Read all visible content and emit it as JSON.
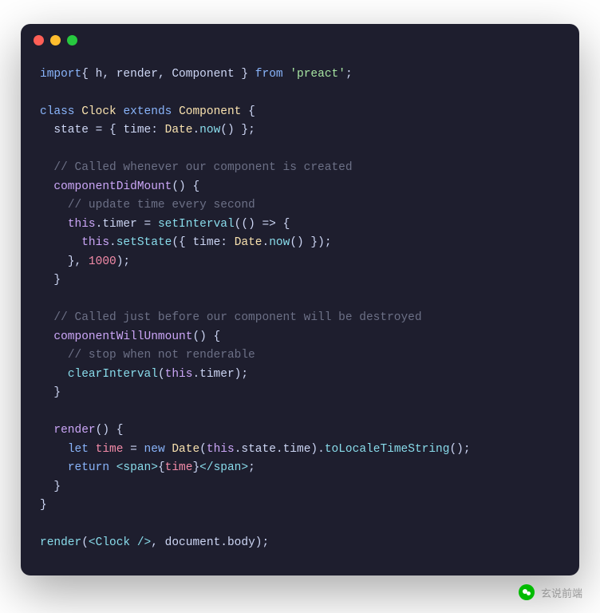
{
  "watermark": "玄说前端",
  "code": {
    "line1": {
      "kw_import": "import",
      "brace_open": "{ ",
      "i1": "h",
      "c1": ", ",
      "i2": "render",
      "c2": ", ",
      "i3": "Component",
      "brace_close": " }",
      "from": " from ",
      "str": "'preact'",
      "semi": ";"
    },
    "line3": {
      "kw_class": "class",
      "sp": " ",
      "name": "Clock",
      "sp2": " ",
      "kw_ext": "extends",
      "sp3": " ",
      "parent": "Component",
      "brace": " {"
    },
    "line4": {
      "indent": "  ",
      "prop": "state",
      "eq": " = { ",
      "key": "time",
      "colon": ": ",
      "obj": "Date",
      "dot": ".",
      "fn": "now",
      "call": "() };"
    },
    "line6": {
      "indent": "  ",
      "comment": "// Called whenever our component is created"
    },
    "line7": {
      "indent": "  ",
      "method": "componentDidMount",
      "call": "() {"
    },
    "line8": {
      "indent": "    ",
      "comment": "// update time every second"
    },
    "line9": {
      "indent": "    ",
      "this": "this",
      "dot": ".",
      "prop": "timer",
      "eq": " = ",
      "fn": "setInterval",
      "open": "(() => {"
    },
    "line10": {
      "indent": "      ",
      "this": "this",
      "dot": ".",
      "fn": "setState",
      "open": "({ ",
      "key": "time",
      "colon": ": ",
      "obj": "Date",
      "dot2": ".",
      "fn2": "now",
      "close": "() });"
    },
    "line11": {
      "indent": "    ",
      "close": "}, ",
      "num": "1000",
      "end": ");"
    },
    "line12": {
      "indent": "  ",
      "close": "}"
    },
    "line14": {
      "indent": "  ",
      "comment": "// Called just before our component will be destroyed"
    },
    "line15": {
      "indent": "  ",
      "method": "componentWillUnmount",
      "call": "() {"
    },
    "line16": {
      "indent": "    ",
      "comment": "// stop when not renderable"
    },
    "line17": {
      "indent": "    ",
      "fn": "clearInterval",
      "open": "(",
      "this": "this",
      "dot": ".",
      "prop": "timer",
      "close": ");"
    },
    "line18": {
      "indent": "  ",
      "close": "}"
    },
    "line20": {
      "indent": "  ",
      "method": "render",
      "call": "() {"
    },
    "line21": {
      "indent": "    ",
      "kw_let": "let",
      "sp": " ",
      "var": "time",
      "eq": " = ",
      "kw_new": "new",
      "sp2": " ",
      "cls": "Date",
      "open": "(",
      "this": "this",
      "dot": ".",
      "p1": "state",
      "dot2": ".",
      "p2": "time",
      "close": ").",
      "fn": "toLocaleTimeString",
      "call2": "();"
    },
    "line22": {
      "indent": "    ",
      "kw_return": "return",
      "sp": " ",
      "tag_open": "<span>",
      "brace": "{",
      "var": "time",
      "brace2": "}",
      "tag_close": "</span>",
      "semi": ";"
    },
    "line23": {
      "indent": "  ",
      "close": "}"
    },
    "line24": {
      "close": "}"
    },
    "line26": {
      "fn": "render",
      "open": "(",
      "tag": "<Clock />",
      "comma": ", ",
      "obj": "document",
      "dot": ".",
      "prop": "body",
      "close": ");"
    }
  }
}
